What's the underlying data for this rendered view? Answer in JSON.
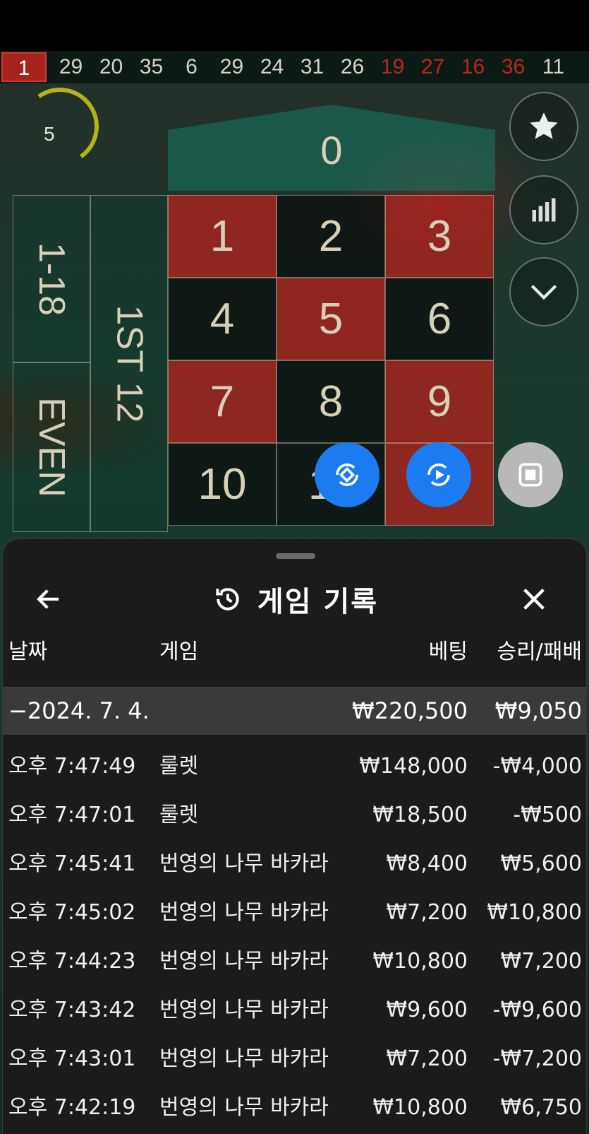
{
  "results": {
    "latest": "1",
    "previous": [
      {
        "n": "29",
        "color": "black"
      },
      {
        "n": "20",
        "color": "black"
      },
      {
        "n": "35",
        "color": "black"
      },
      {
        "n": "6",
        "color": "black"
      },
      {
        "n": "29",
        "color": "black"
      },
      {
        "n": "24",
        "color": "black"
      },
      {
        "n": "31",
        "color": "black"
      },
      {
        "n": "26",
        "color": "black"
      },
      {
        "n": "19",
        "color": "red"
      },
      {
        "n": "27",
        "color": "red"
      },
      {
        "n": "16",
        "color": "red"
      },
      {
        "n": "36",
        "color": "red"
      },
      {
        "n": "11",
        "color": "black"
      }
    ]
  },
  "timer": {
    "value": "5"
  },
  "table": {
    "zero": "0",
    "numbers": [
      {
        "n": "1",
        "color": "red"
      },
      {
        "n": "2",
        "color": "black"
      },
      {
        "n": "3",
        "color": "red"
      },
      {
        "n": "4",
        "color": "black"
      },
      {
        "n": "5",
        "color": "red"
      },
      {
        "n": "6",
        "color": "black"
      },
      {
        "n": "7",
        "color": "red"
      },
      {
        "n": "8",
        "color": "black"
      },
      {
        "n": "9",
        "color": "red"
      },
      {
        "n": "10",
        "color": "black"
      },
      {
        "n": "11",
        "color": "black"
      },
      {
        "n": "12",
        "color": "red"
      }
    ],
    "low_label": "1-18",
    "even_label": "EVEN",
    "dozen_label": "1ST 12"
  },
  "history": {
    "title": "게임 기록",
    "columns": {
      "date": "날짜",
      "game": "게임",
      "bet": "베팅",
      "result": "승리/패배"
    },
    "summary": {
      "date": "−2024. 7. 4.",
      "bet": "₩220,500",
      "result": "₩9,050"
    },
    "rows": [
      {
        "time": "오후 7:47:49",
        "game": "룰렛",
        "bet": "₩148,000",
        "result": "-₩4,000"
      },
      {
        "time": "오후 7:47:01",
        "game": "룰렛",
        "bet": "₩18,500",
        "result": "-₩500"
      },
      {
        "time": "오후 7:45:41",
        "game": "번영의 나무 바카라",
        "bet": "₩8,400",
        "result": "₩5,600"
      },
      {
        "time": "오후 7:45:02",
        "game": "번영의 나무 바카라",
        "bet": "₩7,200",
        "result": "₩10,800"
      },
      {
        "time": "오후 7:44:23",
        "game": "번영의 나무 바카라",
        "bet": "₩10,800",
        "result": "₩7,200"
      },
      {
        "time": "오후 7:43:42",
        "game": "번영의 나무 바카라",
        "bet": "₩9,600",
        "result": "-₩9,600"
      },
      {
        "time": "오후 7:43:01",
        "game": "번영의 나무 바카라",
        "bet": "₩7,200",
        "result": "-₩7,200"
      },
      {
        "time": "오후 7:42:19",
        "game": "번영의 나무 바카라",
        "bet": "₩10,800",
        "result": "₩6,750"
      }
    ]
  },
  "icons": {
    "favorite": "star-icon",
    "stats": "bar-chart-icon",
    "collapse": "chevron-down-icon",
    "undo": "undo-icon",
    "autoplay": "autoplay-icon",
    "stop": "stop-icon",
    "back": "arrow-left-icon",
    "history": "history-icon",
    "close": "close-icon"
  },
  "colors": {
    "red": "#a5231c",
    "felt": "#1b3a2e",
    "accent_blue": "#1a7cf0",
    "panel_bg": "#1b1b1b",
    "summary_bg": "#3a3a3a"
  }
}
